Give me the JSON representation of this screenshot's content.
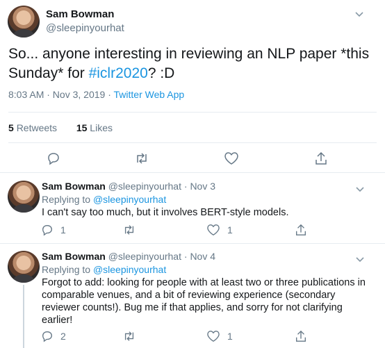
{
  "main_tweet": {
    "author_name": "Sam Bowman",
    "author_handle": "@sleepinyourhat",
    "text_part1": "So... anyone interesting in reviewing an NLP paper *this Sunday* for ",
    "hashtag": "#iclr2020",
    "text_part2": "? :D",
    "time": "8:03 AM · Nov 3, 2019 · ",
    "source": "Twitter Web App",
    "retweets_count": "5",
    "retweets_label": "Retweets",
    "likes_count": "15",
    "likes_label": "Likes"
  },
  "replies": [
    {
      "author_name": "Sam Bowman",
      "author_handle": "@sleepinyourhat",
      "date": "Nov 3",
      "replying_prefix": "Replying to ",
      "replying_to": "@sleepinyourhat",
      "text": "I can't say too much, but it involves BERT-style models.",
      "reply_count": "1",
      "like_count": "1"
    },
    {
      "author_name": "Sam Bowman",
      "author_handle": "@sleepinyourhat",
      "date": "Nov 4",
      "replying_prefix": "Replying to ",
      "replying_to": "@sleepinyourhat",
      "text": "Forgot to add: looking for people with at least two or three publications in comparable venues, and a bit of reviewing experience (secondary reviewer counts!). Bug me if that applies, and sorry for not clarifying earlier!",
      "reply_count": "2",
      "like_count": "1"
    }
  ],
  "separator": " · ",
  "colors": {
    "accent": "#1b95e0",
    "muted": "#657786",
    "border": "#e6ecf0"
  },
  "icons": [
    "chevron-down-icon",
    "reply-icon",
    "retweet-icon",
    "like-icon",
    "share-icon"
  ]
}
